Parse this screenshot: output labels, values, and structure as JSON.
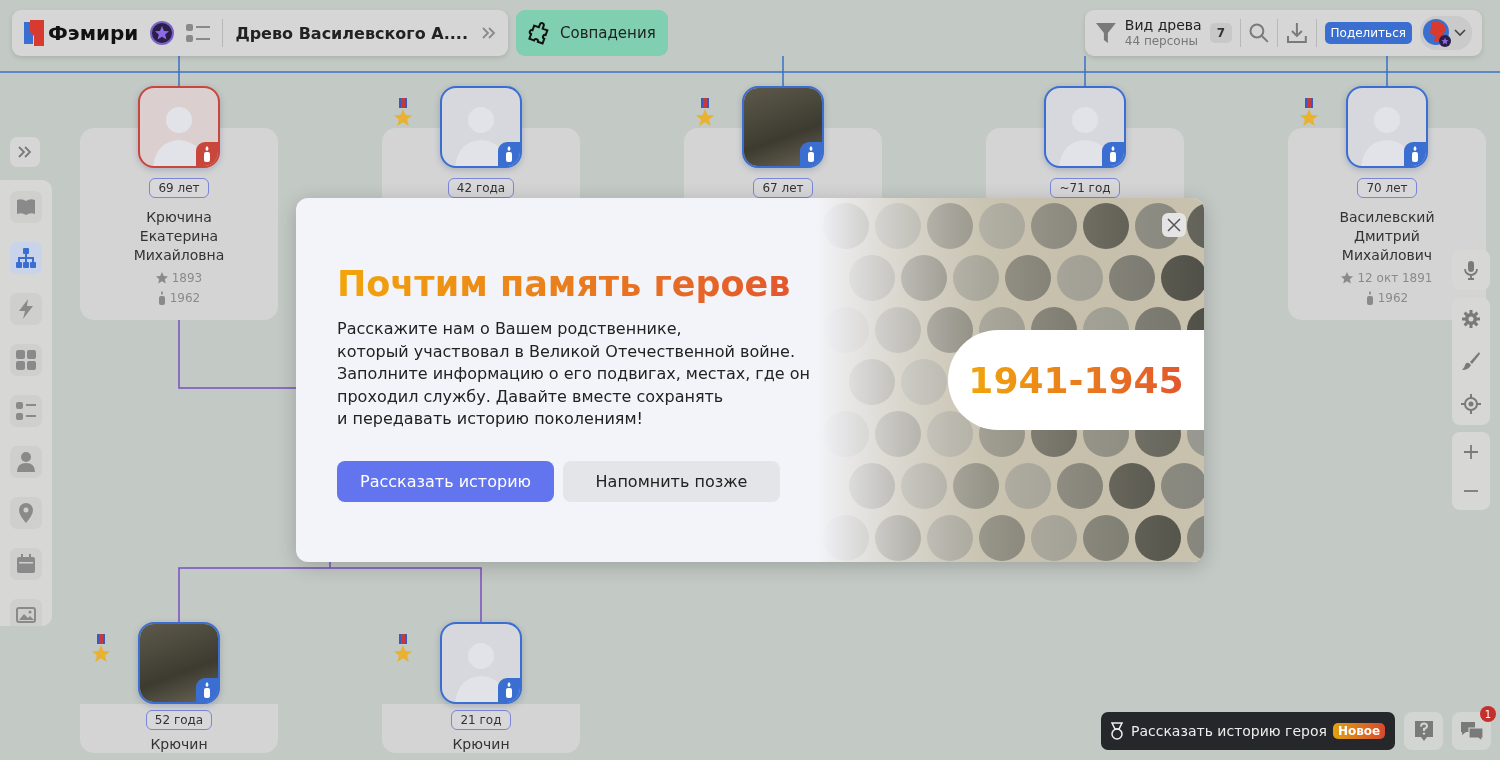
{
  "header": {
    "logo": "Фэмири",
    "tree_title": "Древо Василевского А....",
    "matches_button": "Совпадения"
  },
  "toolbar": {
    "view_label": "Вид древа",
    "persons": "44 персоны",
    "filter_count": "7",
    "share_button": "Поделиться"
  },
  "sidebar": {
    "items": [
      {
        "kind": "book",
        "selected": false
      },
      {
        "kind": "tree",
        "selected": true
      },
      {
        "kind": "bolt",
        "selected": false
      },
      {
        "kind": "grid",
        "selected": false
      },
      {
        "kind": "list",
        "selected": false
      },
      {
        "kind": "person",
        "selected": false
      },
      {
        "kind": "pin",
        "selected": false
      },
      {
        "kind": "calendar",
        "selected": false
      },
      {
        "kind": "image",
        "selected": false
      }
    ]
  },
  "top_row": [
    {
      "age": "69 лет",
      "name": "Крючина Екатерина Михайловна",
      "born": "1893",
      "died": "1962",
      "photo": false,
      "medal": false,
      "color": "#c8463c"
    },
    {
      "age": "42 года",
      "photo": false,
      "medal": true,
      "color": "#3a6fd1"
    },
    {
      "age": "67 лет",
      "photo": true,
      "medal": true,
      "color": "#3a6fd1"
    },
    {
      "age": "~71 год",
      "photo": false,
      "medal": false,
      "color": "#3a6fd1"
    },
    {
      "age": "70 лет",
      "name": "Василевский Дмитрий Михайлович",
      "born": "12 окт 1891",
      "died": "1962",
      "photo": false,
      "medal": true,
      "color": "#3a6fd1"
    }
  ],
  "bottom_row": [
    {
      "age": "52 года",
      "name": "Крючин",
      "photo": true,
      "medal": true,
      "color": "#3a6fd1"
    },
    {
      "age": "21 год",
      "name": "Крючин",
      "photo": false,
      "medal": true,
      "color": "#3a6fd1"
    }
  ],
  "modal": {
    "title": "Почтим память героев",
    "text": "Расскажите нам о Вашем родственнике,\nкоторый участвовал в Великой Отечественной войне.\nЗаполните информацию о его подвигах, местах, где он\nпроходил службу. Давайте вместе сохранять\nи передавать историю поколениям!",
    "primary_button": "Рассказать историю",
    "secondary_button": "Напомнить позже",
    "years": "1941-1945"
  },
  "bottom": {
    "hero_button": "Рассказать историю героя",
    "new_badge": "Новое",
    "chat_badge": "1"
  }
}
